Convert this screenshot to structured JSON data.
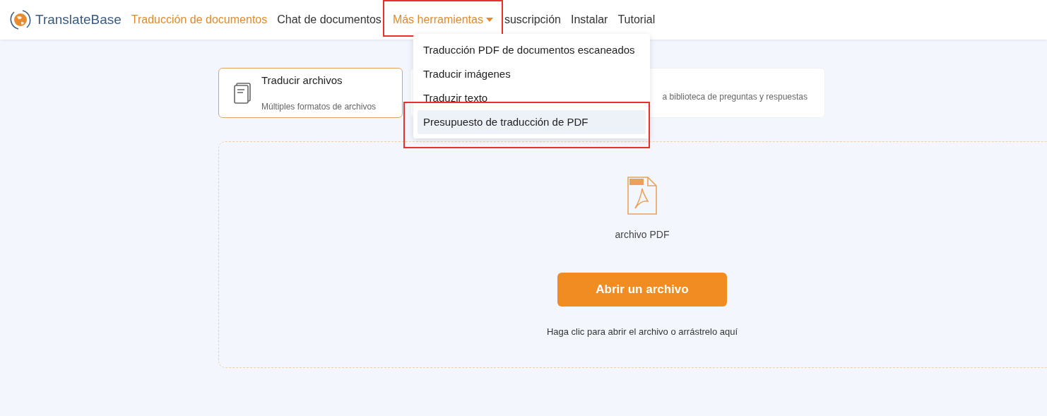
{
  "brand": {
    "name": "TranslateBase"
  },
  "nav": [
    {
      "label": "Traducción de documentos",
      "active": true,
      "kind": "link"
    },
    {
      "label": "Chat de documentos",
      "active": false,
      "kind": "link"
    },
    {
      "label": "Más herramientas",
      "active": true,
      "kind": "dropdown",
      "expanded": true
    },
    {
      "label": "suscripción",
      "active": false,
      "kind": "link"
    },
    {
      "label": "Instalar",
      "active": false,
      "kind": "link"
    },
    {
      "label": "Tutorial",
      "active": false,
      "kind": "link"
    }
  ],
  "dropdown_menu": [
    {
      "label": "Traducción PDF de documentos escaneados",
      "highlighted": false
    },
    {
      "label": "Traducir imágenes",
      "highlighted": false
    },
    {
      "label": "Traduzir texto",
      "highlighted": false
    },
    {
      "label": "Presupuesto de traducción de PDF",
      "highlighted": true
    }
  ],
  "mode_cards": [
    {
      "title": "Traducir archivos",
      "subtitle": "Múltiples formatos de archivos",
      "selected": true
    },
    {
      "subtitle": "a biblioteca de preguntas y respuestas",
      "selected": false
    }
  ],
  "upload": {
    "file_type": "archivo PDF",
    "button": "Abrir un archivo",
    "hint": "Haga clic para abrir el archivo o arrástrelo aquí"
  }
}
